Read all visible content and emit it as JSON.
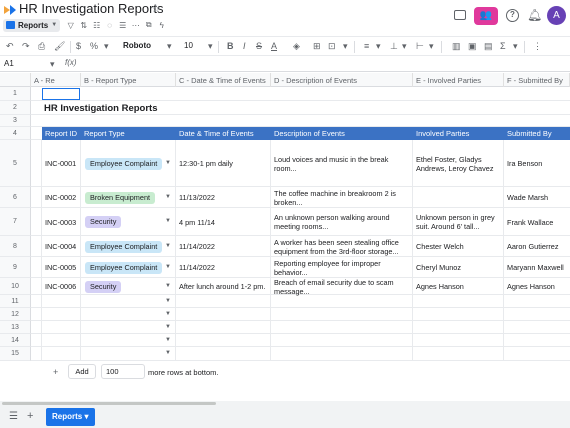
{
  "app": {
    "title": "HR Investigation Reports",
    "view_chip": "Reports",
    "avatar_initial": "A",
    "colors": {
      "accent": "#1a73e8",
      "header_blue": "#3b72c4",
      "share_pink": "#e0399c",
      "avatar_purple": "#6741b5"
    }
  },
  "toolbar": {
    "font": "Roboto",
    "size": "10"
  },
  "formula": {
    "cell_ref": "A1",
    "fx": "f(x)"
  },
  "columns": [
    {
      "label": "A - Re"
    },
    {
      "label": "B - Report Type"
    },
    {
      "label": "C - Date & Time of Events"
    },
    {
      "label": "D - Description of Events"
    },
    {
      "label": "E - Involved Parties"
    },
    {
      "label": "F - Submitted By"
    }
  ],
  "sheet": {
    "title": "HR Investigation Reports",
    "headers": [
      "Report ID",
      "Report Type",
      "Date & Time of Events",
      "Description of Events",
      "Involved Parties",
      "Submitted By"
    ],
    "rows": [
      {
        "id": "INC-0001",
        "type": "Employee Complaint",
        "date": "12:30-1 pm daily",
        "desc": "Loud voices and music in the break room...",
        "parties": "Ethel Foster, Gladys Andrews, Leroy Chavez",
        "by": "Ira Benson"
      },
      {
        "id": "INC-0002",
        "type": "Broken Equipment",
        "date": "11/13/2022",
        "desc": "The coffee machine in breakroom 2 is broken...",
        "parties": "",
        "by": "Wade Marsh"
      },
      {
        "id": "INC-0003",
        "type": "Security",
        "date": "4 pm 11/14",
        "desc": "An unknown person walking around meeting rooms...",
        "parties": "Unknown person in grey suit. Around 6' tall...",
        "by": "Frank Wallace"
      },
      {
        "id": "INC-0004",
        "type": "Employee Complaint",
        "date": "11/14/2022",
        "desc": "A worker has been seen stealing office equipment from the 3rd-floor storage...",
        "parties": "Chester Welch",
        "by": "Aaron Gutierrez"
      },
      {
        "id": "INC-0005",
        "type": "Employee Complaint",
        "date": "11/14/2022",
        "desc": "Reporting employee for improper behavior...",
        "parties": "Cheryl Munoz",
        "by": "Maryann Maxwell"
      },
      {
        "id": "INC-0006",
        "type": "Security",
        "date": "After lunch around 1-2 pm.",
        "desc": "Breach of email security due to scam message...",
        "parties": "Agnes Hanson",
        "by": "Agnes Hanson"
      }
    ],
    "badge_colors": {
      "Employee Complaint": "#c9e6f7",
      "Broken Equipment": "#c8ecd0",
      "Security": "#d4d0f5"
    }
  },
  "footer": {
    "plus": "+",
    "add_label": "Add",
    "rows_value": "100",
    "more_rows_text": "more rows at bottom."
  },
  "bottom": {
    "tab_label": "Reports"
  },
  "row_numbers": [
    "1",
    "2",
    "3",
    "4",
    "5",
    "6",
    "7",
    "8",
    "9",
    "10",
    "11",
    "12",
    "13",
    "14",
    "15"
  ]
}
